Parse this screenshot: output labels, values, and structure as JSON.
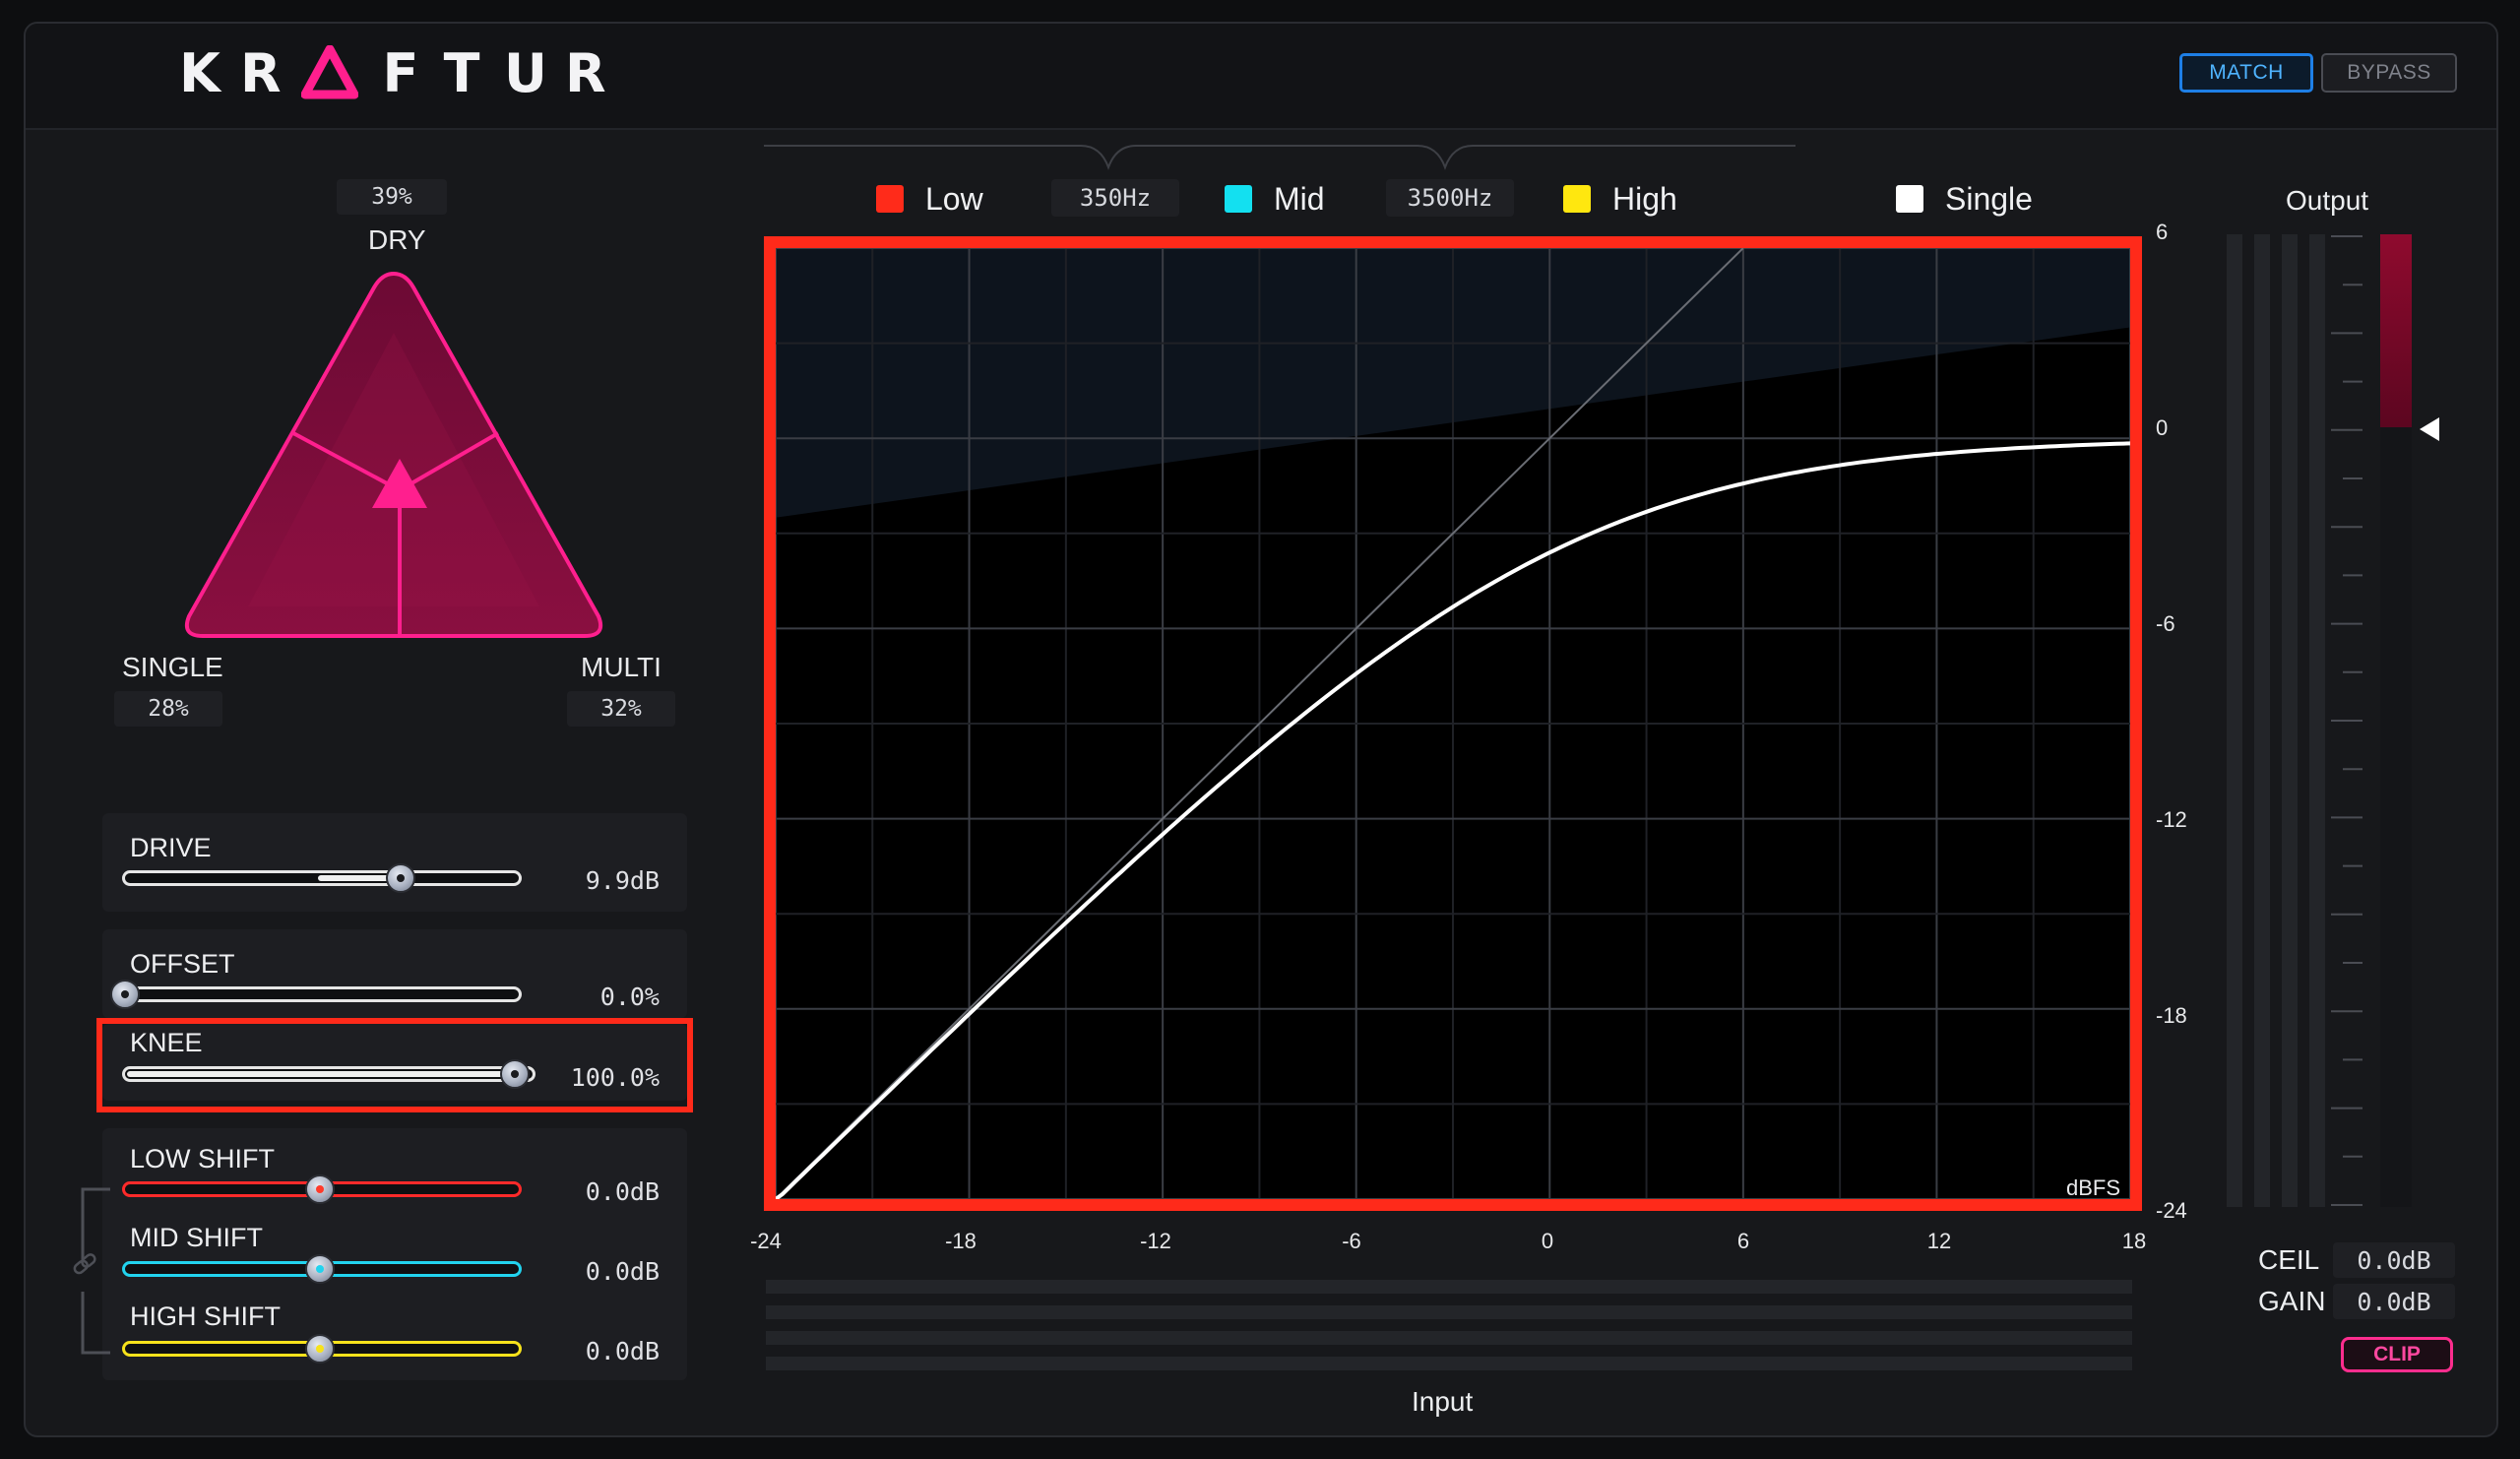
{
  "brand": {
    "letters": [
      "K",
      "R",
      "F",
      "T",
      "U",
      "R"
    ],
    "accent": "#ff1f8e"
  },
  "toolbar": {
    "match_label": "MATCH",
    "bypass_label": "BYPASS"
  },
  "mix": {
    "dry": {
      "label": "DRY",
      "value": "39%"
    },
    "single": {
      "label": "SINGLE",
      "value": "28%"
    },
    "multi": {
      "label": "MULTI",
      "value": "32%"
    }
  },
  "controls": {
    "drive": {
      "label": "DRIVE",
      "value": "9.9dB",
      "position": 0.7
    },
    "offset": {
      "label": "OFFSET",
      "value": "0.0%",
      "position": 0.0
    },
    "knee": {
      "label": "KNEE",
      "value": "100.0%",
      "position": 1.0
    },
    "low_shift": {
      "label": "LOW SHIFT",
      "value": "0.0dB",
      "position": 0.5,
      "color": "#ff2a2a"
    },
    "mid_shift": {
      "label": "MID SHIFT",
      "value": "0.0dB",
      "position": 0.5,
      "color": "#22d3ee"
    },
    "high_shift": {
      "label": "HIGH SHIFT",
      "value": "0.0dB",
      "position": 0.5,
      "color": "#f7e21b"
    }
  },
  "bands": {
    "low": {
      "label": "Low",
      "color": "#ff2b1a"
    },
    "low_mid_freq": "350Hz",
    "mid": {
      "label": "Mid",
      "color": "#13e0f0"
    },
    "mid_high_freq": "3500Hz",
    "high": {
      "label": "High",
      "color": "#ffe70f"
    },
    "single": {
      "label": "Single",
      "color": "#ffffff"
    }
  },
  "graph": {
    "x_ticks": [
      "-24",
      "-18",
      "-12",
      "-6",
      "0",
      "6",
      "12",
      "18"
    ],
    "y_ticks": [
      "6",
      "0",
      "-6",
      "-12",
      "-18",
      "-24"
    ],
    "unit": "dBFS",
    "input_label": "Input",
    "x_range": [
      -24,
      18
    ],
    "y_range": [
      -24,
      6
    ]
  },
  "output": {
    "label": "Output",
    "ceil_label": "CEIL",
    "ceil_value": "0.0dB",
    "gain_label": "GAIN",
    "gain_value": "0.0dB",
    "clip_label": "CLIP"
  }
}
